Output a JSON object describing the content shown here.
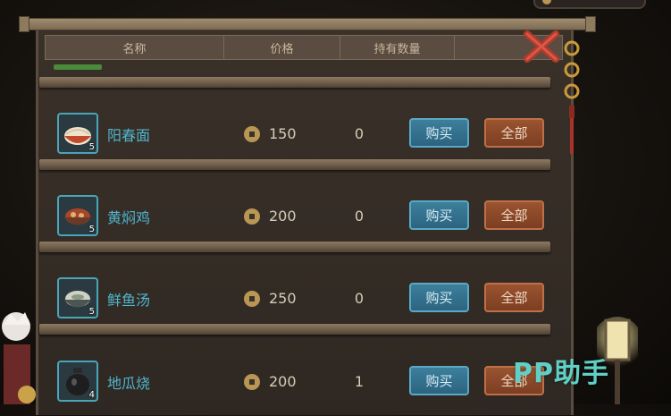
{
  "header": {
    "col_name": "名称",
    "col_price": "价格",
    "col_owned": "持有数量"
  },
  "items": [
    {
      "name": "阳春面",
      "qty": "5",
      "price": "150",
      "owned": "0",
      "buy_label": "购买",
      "all_label": "全部",
      "icon": "noodle-bowl-icon"
    },
    {
      "name": "黄焖鸡",
      "qty": "5",
      "price": "200",
      "owned": "0",
      "buy_label": "购买",
      "all_label": "全部",
      "icon": "braised-chicken-bowl-icon"
    },
    {
      "name": "鲜鱼汤",
      "qty": "5",
      "price": "250",
      "owned": "0",
      "buy_label": "购买",
      "all_label": "全部",
      "icon": "fish-soup-bowl-icon"
    },
    {
      "name": "地瓜烧",
      "qty": "4",
      "price": "200",
      "owned": "1",
      "buy_label": "购买",
      "all_label": "全部",
      "icon": "wine-jar-icon"
    }
  ],
  "watermark": "PP助手",
  "colors": {
    "item_name": "#4fb6cf",
    "buy_button": "#2c6480",
    "all_button": "#7c3e22",
    "watermark": "#5fd0c5"
  }
}
